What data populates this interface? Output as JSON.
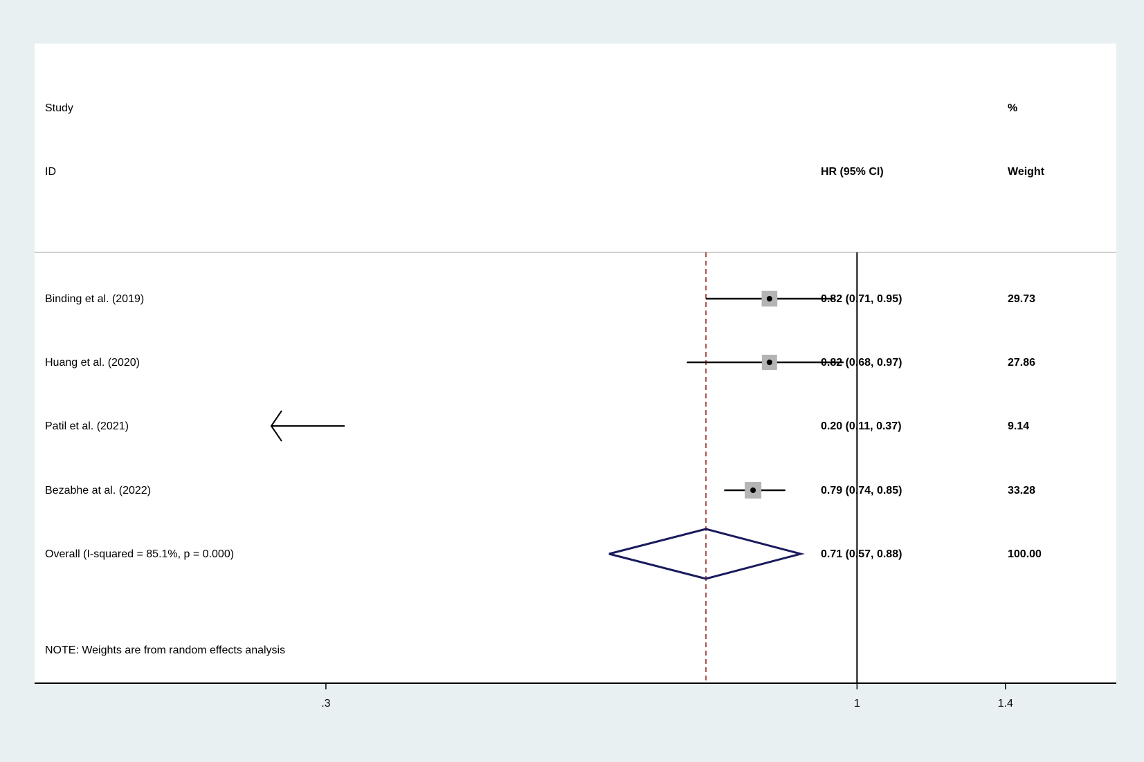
{
  "chart_data": {
    "type": "forest",
    "header": {
      "study": "Study",
      "id": "ID",
      "hr": "HR (95% CI)",
      "pct": "%",
      "weight": "Weight"
    },
    "x_ticks": [
      {
        "value": 0.3,
        "label": ".3"
      },
      {
        "value": 1,
        "label": "1"
      },
      {
        "value": 1.4,
        "label": "1.4"
      }
    ],
    "x_scale": "log",
    "x_range": [
      0.155,
      1.8
    ],
    "null_line": 1,
    "studies": [
      {
        "label": "Binding et al. (2019)",
        "hr": 0.82,
        "lo": 0.71,
        "hi": 0.95,
        "ci_text": "0.82 (0.71, 0.95)",
        "weight": "29.73",
        "weight_value": 29.73
      },
      {
        "label": "Huang et al. (2020)",
        "hr": 0.82,
        "lo": 0.68,
        "hi": 0.97,
        "ci_text": "0.82 (0.68, 0.97)",
        "weight": "27.86",
        "weight_value": 27.86
      },
      {
        "label": "Patil et al. (2021)",
        "hr": 0.2,
        "lo": 0.11,
        "hi": 0.37,
        "ci_text": "0.20 (0.11, 0.37)",
        "weight": "9.14",
        "weight_value": 9.14
      },
      {
        "label": "Bezabhe at al. (2022)",
        "hr": 0.79,
        "lo": 0.74,
        "hi": 0.85,
        "ci_text": "0.79 (0.74, 0.85)",
        "weight": "33.28",
        "weight_value": 33.28
      }
    ],
    "overall": {
      "label": "Overall  (I-squared = 85.1%, p = 0.000)",
      "hr": 0.71,
      "lo": 0.57,
      "hi": 0.88,
      "ci_text": "0.71 (0.57, 0.88)",
      "weight": "100.00"
    },
    "note": "NOTE: Weights are from random effects analysis",
    "colors": {
      "background": "#e9f0f2",
      "plot": "#ffffff",
      "box": "#b4b4b4",
      "overall_diamond": "#1a1a5e",
      "overall_line": "#8b1a1a"
    }
  }
}
